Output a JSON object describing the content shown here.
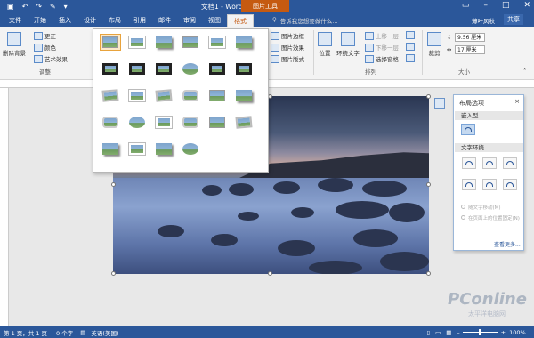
{
  "titlebar": {
    "doc_title": "文档1 - Word",
    "context_tab": "图片工具",
    "quick_access": [
      "save-icon",
      "undo-icon",
      "redo-icon",
      "brush-icon",
      "customize-icon"
    ]
  },
  "tabs": [
    "文件",
    "开始",
    "插入",
    "设计",
    "布局",
    "引用",
    "邮件",
    "审阅",
    "视图",
    "格式"
  ],
  "tellme": "告诉我您想要做什么...",
  "user": "薄叶风秋",
  "share": "共享",
  "ribbon": {
    "remove_bg": "删除背景",
    "corrections": "更正",
    "color": "颜色",
    "artistic": "艺术效果",
    "adjust_group": "调整",
    "picture_border": "图片边框",
    "picture_effects": "图片效果",
    "picture_layout": "图片版式",
    "position": "位置",
    "wrap_text": "环绕文字",
    "bring_forward": "上移一层",
    "send_backward": "下移一层",
    "selection_pane": "选择窗格",
    "arrange_group": "排列",
    "crop": "裁剪",
    "height": "9.56 厘米",
    "width": "17 厘米",
    "size_group": "大小"
  },
  "layout_panel": {
    "title": "布局选项",
    "close": "×",
    "inline": "嵌入型",
    "with_wrapping": "文字环绕",
    "move_with_text": "随文字移动(M)",
    "fix_position": "在页面上的位置固定(N)",
    "see_more": "查看更多..."
  },
  "status": {
    "page": "第 1 页，共 1 页",
    "words": "0 个字",
    "lang": "英语(美国)",
    "zoom": "100%"
  },
  "watermark": {
    "brand": "PConline",
    "sub": "太平洋电脑网"
  }
}
